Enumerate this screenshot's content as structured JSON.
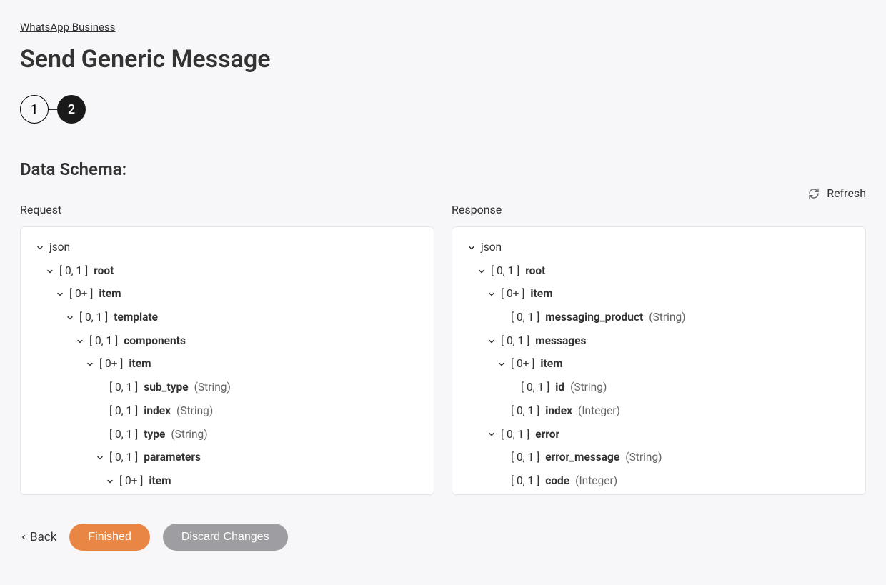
{
  "breadcrumb": "WhatsApp Business",
  "title": "Send Generic Message",
  "stepper": {
    "step1": "1",
    "step2": "2"
  },
  "section_title": "Data Schema:",
  "refresh_label": "Refresh",
  "request_label": "Request",
  "response_label": "Response",
  "colors": {
    "accent": "#ea8644",
    "muted": "#9e9ea2"
  },
  "request_tree": [
    {
      "indent": 0,
      "chevron": true,
      "card": null,
      "name": null,
      "type": null,
      "plain": "json"
    },
    {
      "indent": 1,
      "chevron": true,
      "card": "[ 0, 1 ]",
      "name": "root",
      "type": null
    },
    {
      "indent": 2,
      "chevron": true,
      "card": "[ 0+ ]",
      "name": "item",
      "type": null
    },
    {
      "indent": 3,
      "chevron": true,
      "card": "[ 0, 1 ]",
      "name": "template",
      "type": null
    },
    {
      "indent": 4,
      "chevron": true,
      "card": "[ 0, 1 ]",
      "name": "components",
      "type": null
    },
    {
      "indent": 5,
      "chevron": true,
      "card": "[ 0+ ]",
      "name": "item",
      "type": null
    },
    {
      "indent": 6,
      "chevron": false,
      "card": "[ 0, 1 ]",
      "name": "sub_type",
      "type": "(String)"
    },
    {
      "indent": 6,
      "chevron": false,
      "card": "[ 0, 1 ]",
      "name": "index",
      "type": "(String)"
    },
    {
      "indent": 6,
      "chevron": false,
      "card": "[ 0, 1 ]",
      "name": "type",
      "type": "(String)"
    },
    {
      "indent": 6,
      "chevron": true,
      "card": "[ 0, 1 ]",
      "name": "parameters",
      "type": null
    },
    {
      "indent": 7,
      "chevron": true,
      "card": "[ 0+ ]",
      "name": "item",
      "type": null
    }
  ],
  "response_tree": [
    {
      "indent": 0,
      "chevron": true,
      "card": null,
      "name": null,
      "type": null,
      "plain": "json"
    },
    {
      "indent": 1,
      "chevron": true,
      "card": "[ 0, 1 ]",
      "name": "root",
      "type": null
    },
    {
      "indent": 2,
      "chevron": true,
      "card": "[ 0+ ]",
      "name": "item",
      "type": null
    },
    {
      "indent": 3,
      "chevron": false,
      "card": "[ 0, 1 ]",
      "name": "messaging_product",
      "type": "(String)"
    },
    {
      "indent": 2,
      "chevron": true,
      "card": "[ 0, 1 ]",
      "name": "messages",
      "type": null
    },
    {
      "indent": 3,
      "chevron": true,
      "card": "[ 0+ ]",
      "name": "item",
      "type": null
    },
    {
      "indent": 4,
      "chevron": false,
      "card": "[ 0, 1 ]",
      "name": "id",
      "type": "(String)"
    },
    {
      "indent": 3,
      "chevron": false,
      "card": "[ 0, 1 ]",
      "name": "index",
      "type": "(Integer)"
    },
    {
      "indent": 2,
      "chevron": true,
      "card": "[ 0, 1 ]",
      "name": "error",
      "type": null
    },
    {
      "indent": 3,
      "chevron": false,
      "card": "[ 0, 1 ]",
      "name": "error_message",
      "type": "(String)"
    },
    {
      "indent": 3,
      "chevron": false,
      "card": "[ 0, 1 ]",
      "name": "code",
      "type": "(Integer)"
    }
  ],
  "footer": {
    "back": "Back",
    "finished": "Finished",
    "discard": "Discard Changes"
  }
}
